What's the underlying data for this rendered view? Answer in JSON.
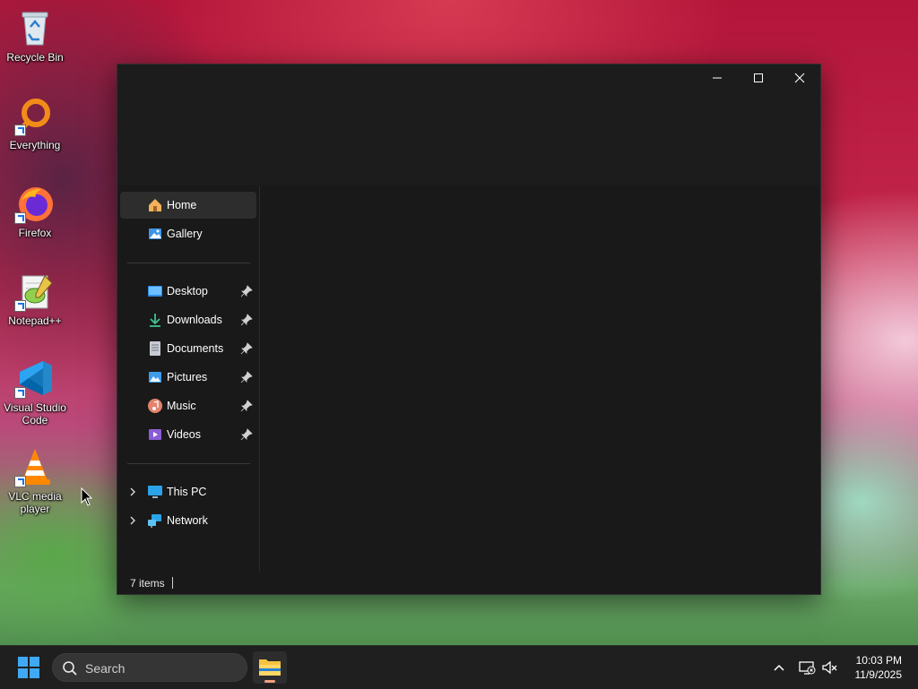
{
  "desktop": {
    "icons": [
      {
        "label": "Recycle Bin",
        "icon": "recycle-bin-icon"
      },
      {
        "label": "Everything",
        "icon": "everything-search-icon"
      },
      {
        "label": "Firefox",
        "icon": "firefox-icon"
      },
      {
        "label": "Notepad++",
        "icon": "notepad-plus-plus-icon"
      },
      {
        "label": "Visual Studio Code",
        "icon": "vscode-icon"
      },
      {
        "label": "VLC media player",
        "icon": "vlc-icon"
      }
    ]
  },
  "explorer": {
    "window_controls": [
      "minimize",
      "maximize",
      "close"
    ],
    "sidebar": {
      "top": [
        {
          "label": "Home",
          "icon": "home-icon",
          "selected": true
        },
        {
          "label": "Gallery",
          "icon": "gallery-icon"
        }
      ],
      "quick_access": [
        {
          "label": "Desktop",
          "icon": "desktop-folder-icon",
          "pinned": true
        },
        {
          "label": "Downloads",
          "icon": "download-icon",
          "pinned": true
        },
        {
          "label": "Documents",
          "icon": "documents-icon",
          "pinned": true
        },
        {
          "label": "Pictures",
          "icon": "pictures-icon",
          "pinned": true
        },
        {
          "label": "Music",
          "icon": "music-icon",
          "pinned": true
        },
        {
          "label": "Videos",
          "icon": "videos-icon",
          "pinned": true
        }
      ],
      "locations": [
        {
          "label": "This PC",
          "icon": "this-pc-icon",
          "expandable": true
        },
        {
          "label": "Network",
          "icon": "network-icon",
          "expandable": true
        }
      ]
    },
    "status": {
      "items_count": "7 items"
    }
  },
  "taskbar": {
    "search_placeholder": "Search",
    "apps": [
      {
        "name": "File Explorer",
        "icon": "file-explorer-icon",
        "active": true
      }
    ],
    "tray": [
      "show-hidden-icons-icon",
      "network-disconnected-icon",
      "volume-muted-icon"
    ],
    "clock": {
      "time": "10:03 PM",
      "date": "11/9/2025"
    }
  },
  "colors": {
    "window_bg": "#191919",
    "selected_bg": "#2d2d2d",
    "taskbar_bg": "#1f1f1f",
    "accent": "#0078d4"
  }
}
